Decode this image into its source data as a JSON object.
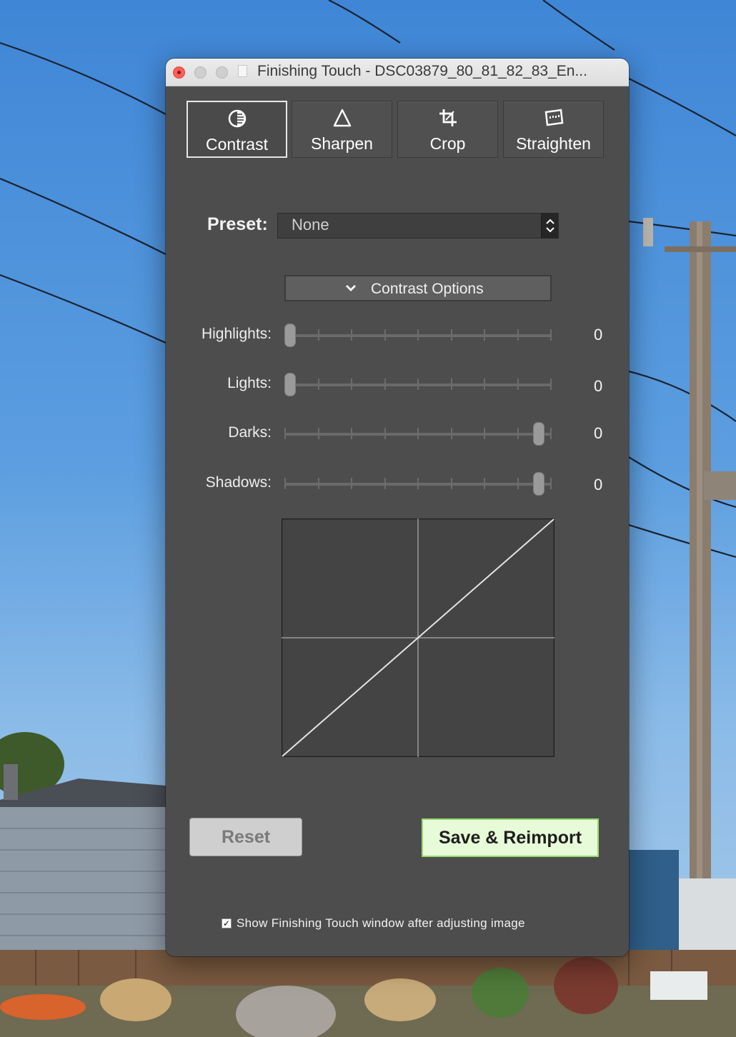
{
  "window": {
    "title": "Finishing Touch - DSC03879_80_81_82_83_En..."
  },
  "tabs": [
    {
      "label": "Contrast",
      "icon": "contrast-icon",
      "active": true
    },
    {
      "label": "Sharpen",
      "icon": "sharpen-triangle-icon",
      "active": false
    },
    {
      "label": "Crop",
      "icon": "crop-icon",
      "active": false
    },
    {
      "label": "Straighten",
      "icon": "straighten-icon",
      "active": false
    }
  ],
  "preset": {
    "label": "Preset:",
    "value": "None"
  },
  "options": {
    "label": "Contrast Options",
    "expanded": true
  },
  "sliders": [
    {
      "label": "Highlights:",
      "value": "0",
      "position": 0.0
    },
    {
      "label": "Lights:",
      "value": "0",
      "position": 0.0
    },
    {
      "label": "Darks:",
      "value": "0",
      "position": 1.0
    },
    {
      "label": "Shadows:",
      "value": "0",
      "position": 1.0
    }
  ],
  "buttons": {
    "reset": "Reset",
    "save": "Save & Reimport"
  },
  "checkbox": {
    "label": "Show Finishing Touch window after adjusting image",
    "checked": true
  },
  "colors": {
    "panel": "#4d4d4d",
    "save_bg": "#e8fbd8",
    "save_border": "#9ad86f",
    "close": "#fe5f57"
  }
}
